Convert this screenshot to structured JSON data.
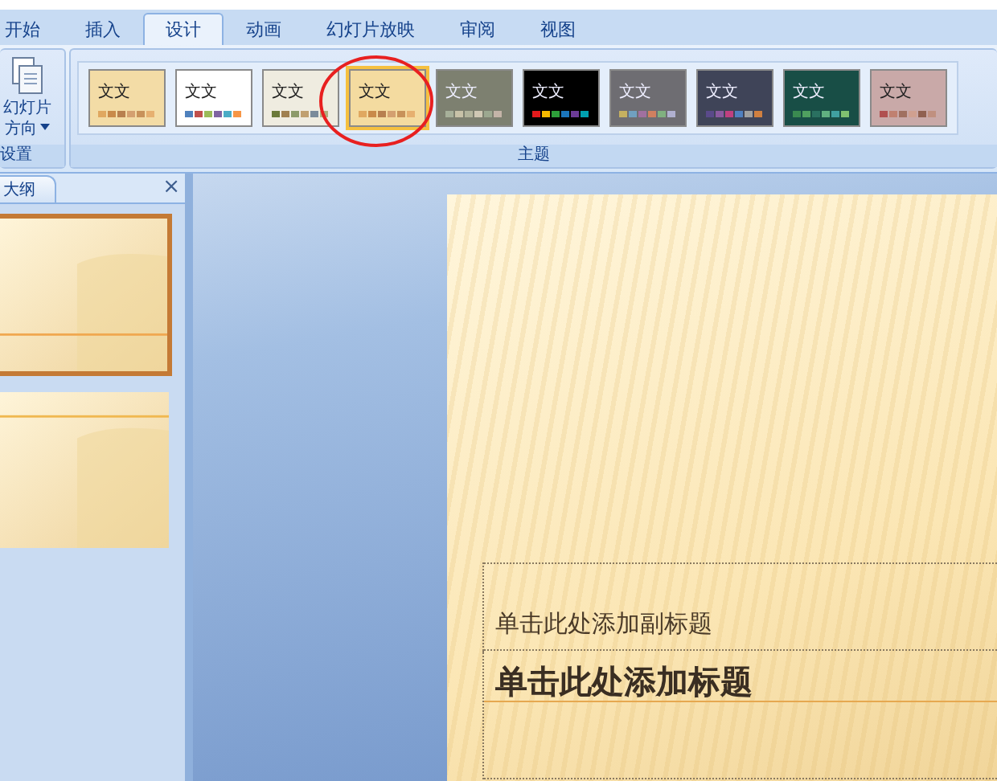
{
  "ribbon_tabs": [
    {
      "label": "开始",
      "selected": false
    },
    {
      "label": "插入",
      "selected": false
    },
    {
      "label": "设计",
      "selected": true
    },
    {
      "label": "动画",
      "selected": false
    },
    {
      "label": "幻灯片放映",
      "selected": false
    },
    {
      "label": "审阅",
      "selected": false
    },
    {
      "label": "视图",
      "selected": false
    }
  ],
  "page_setup_group": {
    "button_lines": [
      "幻灯片",
      "方向"
    ],
    "label": "设置"
  },
  "themes_group": {
    "label": "主题",
    "themes": [
      {
        "label": "文文",
        "color": "#f3dca6",
        "selected": false
      },
      {
        "label": "文文",
        "color": "#ffffff",
        "selected": false
      },
      {
        "label": "文文",
        "color": "#efece0",
        "selected": false
      },
      {
        "label": "文文",
        "color": "#f4dba0",
        "selected": true
      },
      {
        "label": "文文",
        "color": "#7d8070",
        "selected": false
      },
      {
        "label": "文文",
        "color": "#000000",
        "selected": false
      },
      {
        "label": "文文",
        "color": "#6e6d72",
        "selected": false
      },
      {
        "label": "文文",
        "color": "#3f4458",
        "selected": false
      },
      {
        "label": "文文",
        "color": "#184e46",
        "selected": false
      },
      {
        "label": "文文",
        "color": "#c9a9a8",
        "selected": false
      }
    ]
  },
  "pane": {
    "tab": "大纲",
    "close": "×",
    "slides": [
      {
        "selected": true,
        "kind": "title"
      },
      {
        "selected": false,
        "kind": "content"
      }
    ]
  },
  "slide": {
    "subtitle_placeholder": "单击此处添加副标题",
    "title_placeholder": "单击此处添加标题"
  }
}
